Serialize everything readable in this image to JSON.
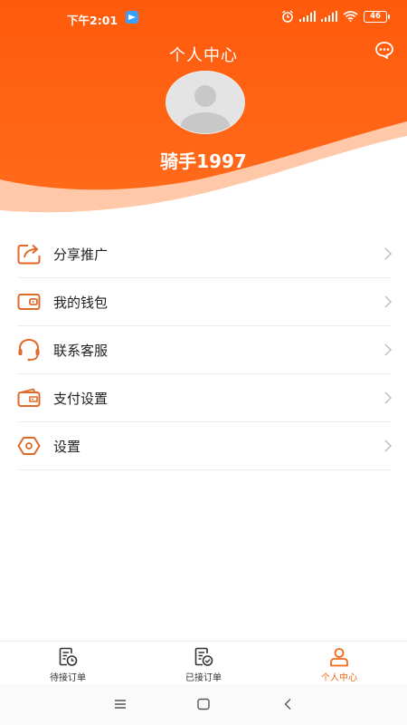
{
  "colors": {
    "accent": "#f26a1b",
    "header_orange": "#ff5a0c",
    "icon_orange": "#e06a2a"
  },
  "status_bar": {
    "time": "下午2:01",
    "battery": "46"
  },
  "header": {
    "title": "个人中心",
    "username": "骑手1997"
  },
  "menu": {
    "items": [
      {
        "label": "分享推广",
        "icon": "share-icon"
      },
      {
        "label": "我的钱包",
        "icon": "wallet-icon"
      },
      {
        "label": "联系客服",
        "icon": "headset-icon"
      },
      {
        "label": "支付设置",
        "icon": "payment-wallet-icon"
      },
      {
        "label": "设置",
        "icon": "settings-hexagon-icon"
      }
    ]
  },
  "tabbar": {
    "tabs": [
      {
        "label": "待接订单",
        "icon": "order-clock-icon",
        "active": false
      },
      {
        "label": "已接订单",
        "icon": "order-check-icon",
        "active": false
      },
      {
        "label": "个人中心",
        "icon": "person-icon",
        "active": true
      }
    ]
  },
  "system_nav": {
    "buttons": [
      "menu-icon",
      "home-icon",
      "back-icon"
    ]
  }
}
